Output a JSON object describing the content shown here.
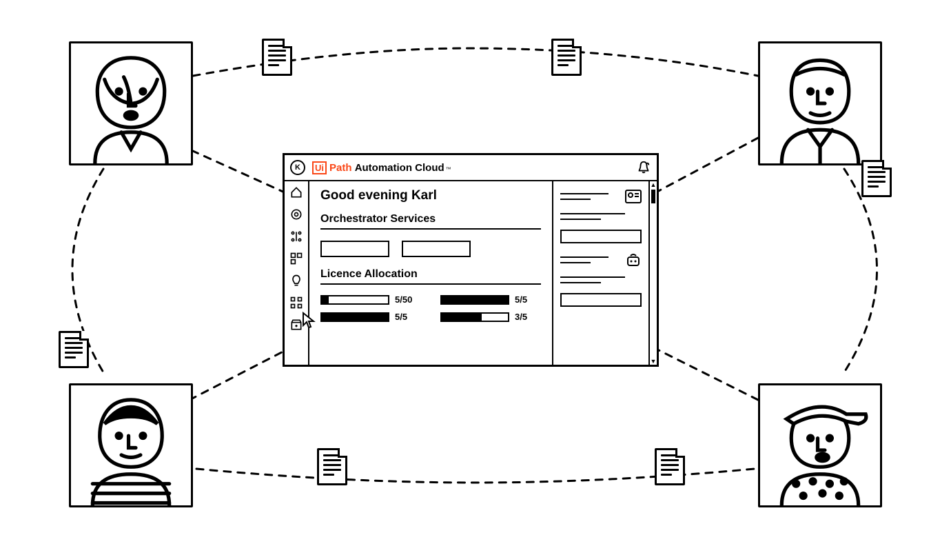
{
  "brand": {
    "ui": "Ui",
    "path": "Path",
    "product": "Automation Cloud",
    "tm": "™"
  },
  "avatar_initial": "K",
  "greeting": "Good evening Karl",
  "sections": {
    "orchestrator": "Orchestrator Services",
    "licence": "Licence Allocation"
  },
  "licences": [
    {
      "label": "5/50",
      "fill_pct": 10
    },
    {
      "label": "5/5",
      "fill_pct": 100
    },
    {
      "label": "5/5",
      "fill_pct": 100
    },
    {
      "label": "3/5",
      "fill_pct": 60
    }
  ],
  "diagram": {
    "users": [
      "user-top-left",
      "user-top-right",
      "user-bottom-left",
      "user-bottom-right"
    ],
    "doc_icon_count": 6
  }
}
